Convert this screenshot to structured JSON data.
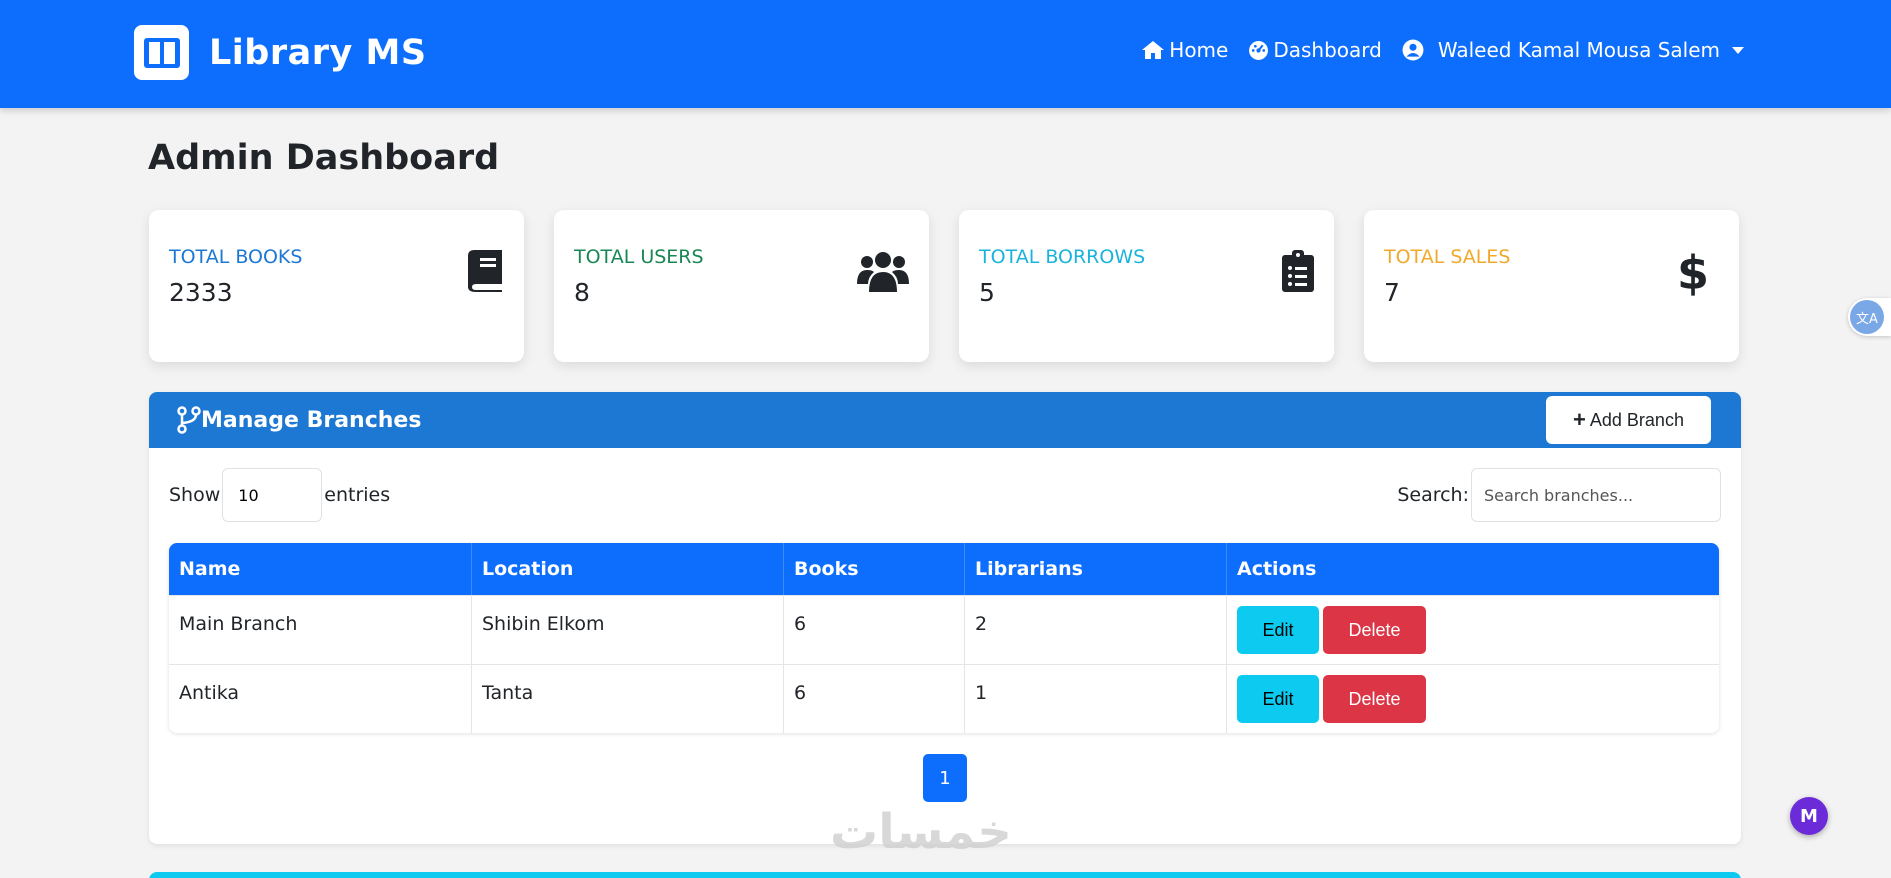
{
  "navbar": {
    "brand": "Library MS",
    "links": [
      {
        "label": "Home",
        "icon": "home-icon"
      },
      {
        "label": "Dashboard",
        "icon": "dashboard-icon"
      }
    ],
    "user_name": "Waleed Kamal Mousa Salem",
    "bg_color": "#0d6efd"
  },
  "page_title": "Admin Dashboard",
  "stats": [
    {
      "label": "TOTAL BOOKS",
      "value": "2333",
      "color": "#0d6efd",
      "icon": "book-icon"
    },
    {
      "label": "TOTAL USERS",
      "value": "8",
      "color": "#198754",
      "icon": "users-icon"
    },
    {
      "label": "TOTAL BORROWS",
      "value": "5",
      "color": "#0dcaf0",
      "icon": "clipboard-list-icon"
    },
    {
      "label": "TOTAL SALES",
      "value": "7",
      "color": "#ffc107",
      "icon": "dollar-icon"
    }
  ],
  "branches_panel": {
    "title": "Manage Branches",
    "add_button": "Add Branch",
    "show_label": "Show",
    "entries_value": "10",
    "entries_label": "entries",
    "search_label": "Search:",
    "search_placeholder": "Search branches...",
    "columns": [
      "Name",
      "Location",
      "Books",
      "Librarians",
      "Actions"
    ],
    "rows": [
      {
        "name": "Main Branch",
        "location": "Shibin Elkom",
        "books": "6",
        "librarians": "2"
      },
      {
        "name": "Antika",
        "location": "Tanta",
        "books": "6",
        "librarians": "1"
      }
    ],
    "edit_label": "Edit",
    "delete_label": "Delete",
    "current_page": "1"
  },
  "watermark": "خمسات",
  "floating": {
    "translate_label": "文A",
    "m_label": "M"
  }
}
